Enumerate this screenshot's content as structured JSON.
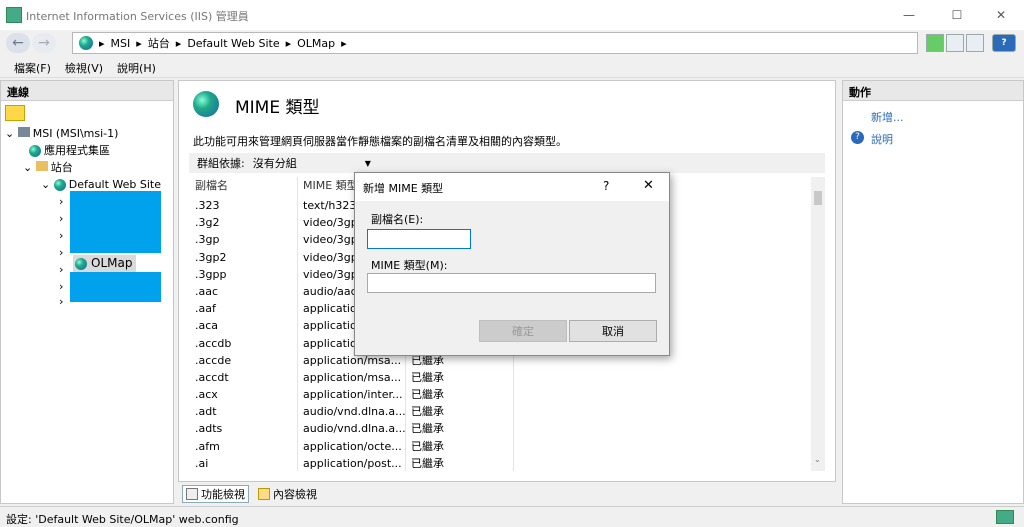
{
  "window": {
    "title": "Internet Information Services (IIS) 管理員",
    "minimize_glyph": "—",
    "maximize_glyph": "☐",
    "close_glyph": "✕"
  },
  "nav": {
    "back_glyph": "←",
    "forward_glyph": "→",
    "breadcrumb": [
      "MSI",
      "站台",
      "Default Web Site",
      "OLMap"
    ],
    "sep": "▸",
    "help_glyph": "?"
  },
  "menu": [
    "檔案(F)",
    "檢視(V)",
    "說明(H)"
  ],
  "left": {
    "header": "連線",
    "tree": {
      "server": "MSI (MSI\\msi-1)",
      "app_pools": "應用程式集區",
      "sites": "站台",
      "site": "Default Web Site",
      "selected": "OLMap"
    }
  },
  "center": {
    "title": "MIME 類型",
    "description": "此功能可用來管理網頁伺服器當作靜態檔案的副檔名清單及相關的內容類型。",
    "group_label": "群組依據:",
    "group_value": "沒有分組",
    "columns": [
      "副檔名",
      "MIME 類型"
    ],
    "rows": [
      [
        ".323",
        "text/h323",
        ""
      ],
      [
        ".3g2",
        "video/3gpp2",
        ""
      ],
      [
        ".3gp",
        "video/3gpp",
        ""
      ],
      [
        ".3gp2",
        "video/3gpp2",
        ""
      ],
      [
        ".3gpp",
        "video/3gpp",
        ""
      ],
      [
        ".aac",
        "audio/aac",
        ""
      ],
      [
        ".aaf",
        "application/octet-stream",
        ""
      ],
      [
        ".aca",
        "application/octet-stream",
        ""
      ],
      [
        ".accdb",
        "application/msaccess",
        ""
      ],
      [
        ".accde",
        "application/msa...",
        "已繼承"
      ],
      [
        ".accdt",
        "application/msa...",
        "已繼承"
      ],
      [
        ".acx",
        "application/inter...",
        "已繼承"
      ],
      [
        ".adt",
        "audio/vnd.dlna.a...",
        "已繼承"
      ],
      [
        ".adts",
        "audio/vnd.dlna.a...",
        "已繼承"
      ],
      [
        ".afm",
        "application/octe...",
        "已繼承"
      ],
      [
        ".ai",
        "application/post...",
        "已繼承"
      ]
    ],
    "tabs": [
      "功能檢視",
      "內容檢視"
    ]
  },
  "right": {
    "header": "動作",
    "actions": [
      "新增...",
      "說明"
    ]
  },
  "status": "設定: 'Default Web Site/OLMap' web.config",
  "dialog": {
    "title": "新增 MIME 類型",
    "help_glyph": "?",
    "close_glyph": "✕",
    "ext_label": "副檔名(E):",
    "ext_value": "",
    "mime_label": "MIME 類型(M):",
    "mime_value": "",
    "ok": "確定",
    "cancel": "取消"
  },
  "colors": {
    "selection": "#00a2ed",
    "accent": "#2a6ab8"
  }
}
